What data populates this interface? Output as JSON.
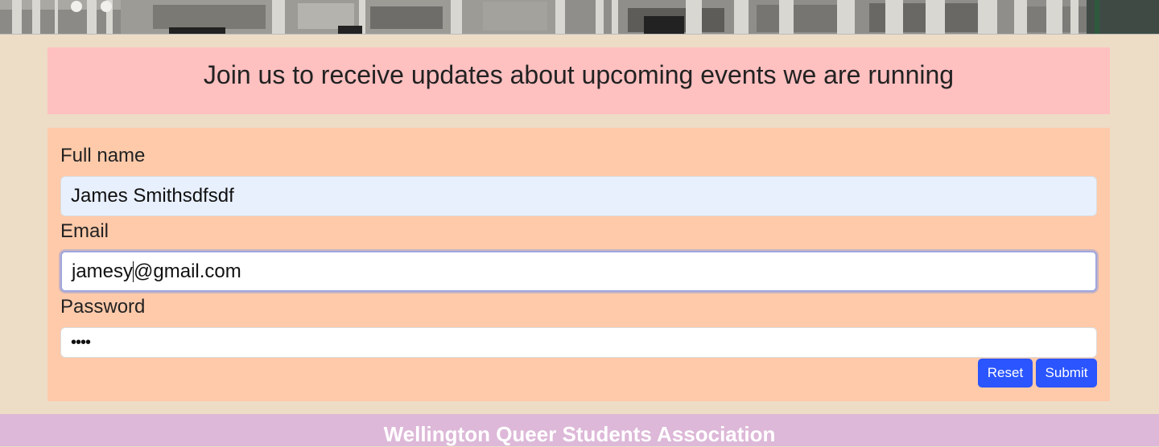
{
  "banner": {
    "heading": "Join us to receive updates about upcoming events we are running"
  },
  "form": {
    "full_name": {
      "label": "Full name",
      "value": "James Smithsdfsdf"
    },
    "email": {
      "label": "Email",
      "value_before_caret": "jamesy",
      "value_after_caret": "@gmail.com"
    },
    "password": {
      "label": "Password",
      "masked_value": "••••"
    },
    "reset_label": "Reset",
    "submit_label": "Submit"
  },
  "footer": {
    "title": "Wellington Queer Students Association"
  },
  "colors": {
    "page_bg": "#eddcc6",
    "banner_bg": "#ffc0c0",
    "form_bg": "#ffcaaa",
    "button_bg": "#2a55ff",
    "footer_bg": "#ddb8d8"
  }
}
